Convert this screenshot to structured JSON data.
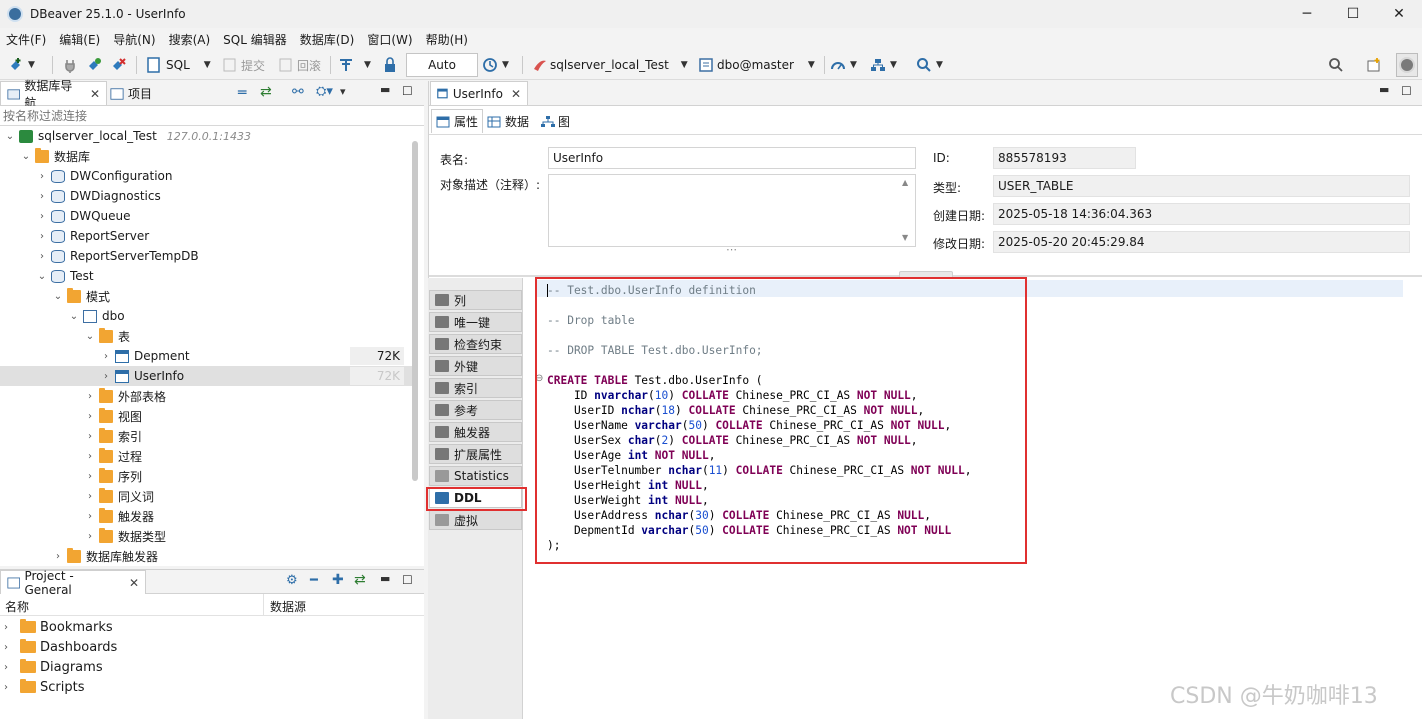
{
  "window": {
    "title": "DBeaver 25.1.0 - UserInfo",
    "minimize": "─",
    "maximize": "☐",
    "close": "✕"
  },
  "menu": [
    "文件(F)",
    "编辑(E)",
    "导航(N)",
    "搜索(A)",
    "SQL 编辑器",
    "数据库(D)",
    "窗口(W)",
    "帮助(H)"
  ],
  "toolbar": {
    "sql": "SQL",
    "commit": "提交",
    "rollback": "回滚",
    "transaction_mode": "Auto",
    "connection": "sqlserver_local_Test",
    "schema": "dbo@master"
  },
  "navigator": {
    "tab_db": "数据库导航",
    "tab_project": "项目",
    "filter_placeholder": "按名称过滤连接",
    "tree": [
      {
        "label": "sqlserver_local_Test",
        "hint": "127.0.0.1:1433",
        "icon": "connection-icon",
        "open": true
      },
      {
        "label": "数据库",
        "icon": "folder-icon",
        "open": true
      },
      {
        "label": "DWConfiguration",
        "icon": "database-icon"
      },
      {
        "label": "DWDiagnostics",
        "icon": "database-icon"
      },
      {
        "label": "DWQueue",
        "icon": "database-icon"
      },
      {
        "label": "ReportServer",
        "icon": "database-icon"
      },
      {
        "label": "ReportServerTempDB",
        "icon": "database-icon"
      },
      {
        "label": "Test",
        "icon": "database-icon",
        "open": true
      },
      {
        "label": "模式",
        "icon": "folder-icon",
        "open": true
      },
      {
        "label": "dbo",
        "icon": "schema-icon",
        "open": true
      },
      {
        "label": "表",
        "icon": "folder-icon",
        "open": true
      },
      {
        "label": "Depment",
        "icon": "table-icon",
        "size": "72K"
      },
      {
        "label": "UserInfo",
        "icon": "table-icon",
        "size": "72K"
      },
      {
        "label": "外部表格",
        "icon": "folder-icon"
      },
      {
        "label": "视图",
        "icon": "folder-icon"
      },
      {
        "label": "索引",
        "icon": "folder-icon"
      },
      {
        "label": "过程",
        "icon": "folder-icon"
      },
      {
        "label": "序列",
        "icon": "folder-icon"
      },
      {
        "label": "同义词",
        "icon": "folder-icon"
      },
      {
        "label": "触发器",
        "icon": "folder-icon"
      },
      {
        "label": "数据类型",
        "icon": "folder-icon"
      },
      {
        "label": "数据库触发器",
        "icon": "folder-icon"
      }
    ]
  },
  "project": {
    "tab": "Project - General",
    "col_name": "名称",
    "col_source": "数据源",
    "items": [
      "Bookmarks",
      "Dashboards",
      "Diagrams",
      "Scripts"
    ]
  },
  "editor": {
    "tab": "UserInfo",
    "subtabs": [
      "属性",
      "数据",
      "图"
    ],
    "props": {
      "table_name_label": "表名:",
      "table_name": "UserInfo",
      "desc_label": "对象描述（注释）:",
      "id_label": "ID:",
      "id": "885578193",
      "type_label": "类型:",
      "type": "USER_TABLE",
      "created_label": "创建日期:",
      "created": "2025-05-18 14:36:04.363",
      "modified_label": "修改日期:",
      "modified": "2025-05-20 20:45:29.84"
    },
    "side_tabs": [
      "列",
      "唯一键",
      "检查约束",
      "外键",
      "索引",
      "参考",
      "触发器",
      "扩展属性",
      "Statistics",
      "DDL",
      "虚拟"
    ],
    "active_side_tab": "DDL"
  },
  "ddl": [
    [
      [
        "cm",
        "-- Test.dbo.UserInfo definition"
      ]
    ],
    [],
    [
      [
        "cm",
        "-- Drop table"
      ]
    ],
    [],
    [
      [
        "cm",
        "-- DROP TABLE Test.dbo.UserInfo;"
      ]
    ],
    [],
    [
      [
        "kw",
        "CREATE TABLE"
      ],
      [
        "t",
        " Test.dbo.UserInfo ("
      ]
    ],
    [
      [
        "t",
        "    ID "
      ],
      [
        "ty",
        "nvarchar"
      ],
      [
        "t",
        "("
      ],
      [
        "nm",
        "10"
      ],
      [
        "t",
        ") "
      ],
      [
        "kw",
        "COLLATE"
      ],
      [
        "t",
        " Chinese_PRC_CI_AS "
      ],
      [
        "kw",
        "NOT NULL"
      ],
      [
        "t",
        ","
      ]
    ],
    [
      [
        "t",
        "    UserID "
      ],
      [
        "ty",
        "nchar"
      ],
      [
        "t",
        "("
      ],
      [
        "nm",
        "18"
      ],
      [
        "t",
        ") "
      ],
      [
        "kw",
        "COLLATE"
      ],
      [
        "t",
        " Chinese_PRC_CI_AS "
      ],
      [
        "kw",
        "NOT NULL"
      ],
      [
        "t",
        ","
      ]
    ],
    [
      [
        "t",
        "    UserName "
      ],
      [
        "ty",
        "varchar"
      ],
      [
        "t",
        "("
      ],
      [
        "nm",
        "50"
      ],
      [
        "t",
        ") "
      ],
      [
        "kw",
        "COLLATE"
      ],
      [
        "t",
        " Chinese_PRC_CI_AS "
      ],
      [
        "kw",
        "NOT NULL"
      ],
      [
        "t",
        ","
      ]
    ],
    [
      [
        "t",
        "    UserSex "
      ],
      [
        "ty",
        "char"
      ],
      [
        "t",
        "("
      ],
      [
        "nm",
        "2"
      ],
      [
        "t",
        ") "
      ],
      [
        "kw",
        "COLLATE"
      ],
      [
        "t",
        " Chinese_PRC_CI_AS "
      ],
      [
        "kw",
        "NOT NULL"
      ],
      [
        "t",
        ","
      ]
    ],
    [
      [
        "t",
        "    UserAge "
      ],
      [
        "ty",
        "int"
      ],
      [
        "t",
        " "
      ],
      [
        "kw",
        "NOT NULL"
      ],
      [
        "t",
        ","
      ]
    ],
    [
      [
        "t",
        "    UserTelnumber "
      ],
      [
        "ty",
        "nchar"
      ],
      [
        "t",
        "("
      ],
      [
        "nm",
        "11"
      ],
      [
        "t",
        ") "
      ],
      [
        "kw",
        "COLLATE"
      ],
      [
        "t",
        " Chinese_PRC_CI_AS "
      ],
      [
        "kw",
        "NOT NULL"
      ],
      [
        "t",
        ","
      ]
    ],
    [
      [
        "t",
        "    UserHeight "
      ],
      [
        "ty",
        "int"
      ],
      [
        "t",
        " "
      ],
      [
        "kw",
        "NULL"
      ],
      [
        "t",
        ","
      ]
    ],
    [
      [
        "t",
        "    UserWeight "
      ],
      [
        "ty",
        "int"
      ],
      [
        "t",
        " "
      ],
      [
        "kw",
        "NULL"
      ],
      [
        "t",
        ","
      ]
    ],
    [
      [
        "t",
        "    UserAddress "
      ],
      [
        "ty",
        "nchar"
      ],
      [
        "t",
        "("
      ],
      [
        "nm",
        "30"
      ],
      [
        "t",
        ") "
      ],
      [
        "kw",
        "COLLATE"
      ],
      [
        "t",
        " Chinese_PRC_CI_AS "
      ],
      [
        "kw",
        "NULL"
      ],
      [
        "t",
        ","
      ]
    ],
    [
      [
        "t",
        "    DepmentId "
      ],
      [
        "ty",
        "varchar"
      ],
      [
        "t",
        "("
      ],
      [
        "nm",
        "50"
      ],
      [
        "t",
        ") "
      ],
      [
        "kw",
        "COLLATE"
      ],
      [
        "t",
        " Chinese_PRC_CI_AS "
      ],
      [
        "kw",
        "NOT NULL"
      ]
    ],
    [
      [
        "t",
        ");"
      ]
    ]
  ],
  "watermark": "CSDN @牛奶咖啡13"
}
